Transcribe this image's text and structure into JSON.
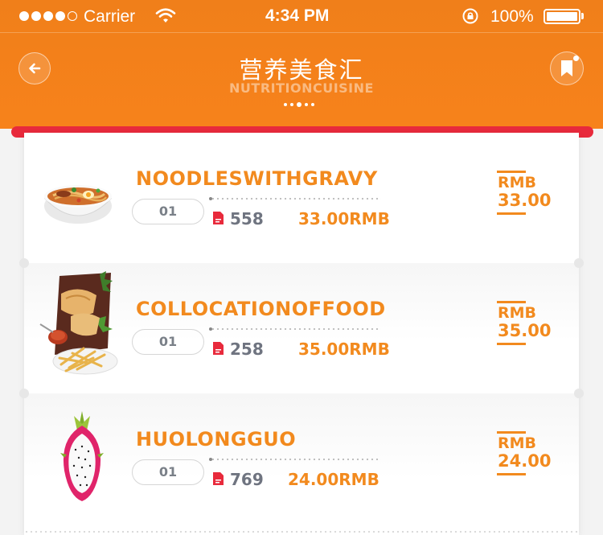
{
  "status_bar": {
    "carrier": "Carrier",
    "time": "4:34 PM",
    "battery": "100%"
  },
  "header": {
    "title": "营养美食汇",
    "subtitle": "NUTRITIONCUISINE",
    "back_icon": "arrow-left-icon",
    "bookmark_icon": "bookmark-icon"
  },
  "colors": {
    "header_bg": "#f7821b",
    "accent": "#f28a1e",
    "strip": "#e82a3c"
  },
  "items": [
    {
      "name": "NOODLESWITHGRAVY",
      "quantity": "01",
      "count": "558",
      "total": "33.00RMB",
      "currency": "RMB",
      "price": "33.00",
      "image": "noodle-bowl"
    },
    {
      "name": "COLLOCATIONOFFOOD",
      "quantity": "01",
      "count": "258",
      "total": "35.00RMB",
      "currency": "RMB",
      "price": "35.00",
      "image": "food-platter"
    },
    {
      "name": "HUOLONGGUO",
      "quantity": "01",
      "count": "769",
      "total": "24.00RMB",
      "currency": "RMB",
      "price": "24.00",
      "image": "dragon-fruit"
    }
  ]
}
